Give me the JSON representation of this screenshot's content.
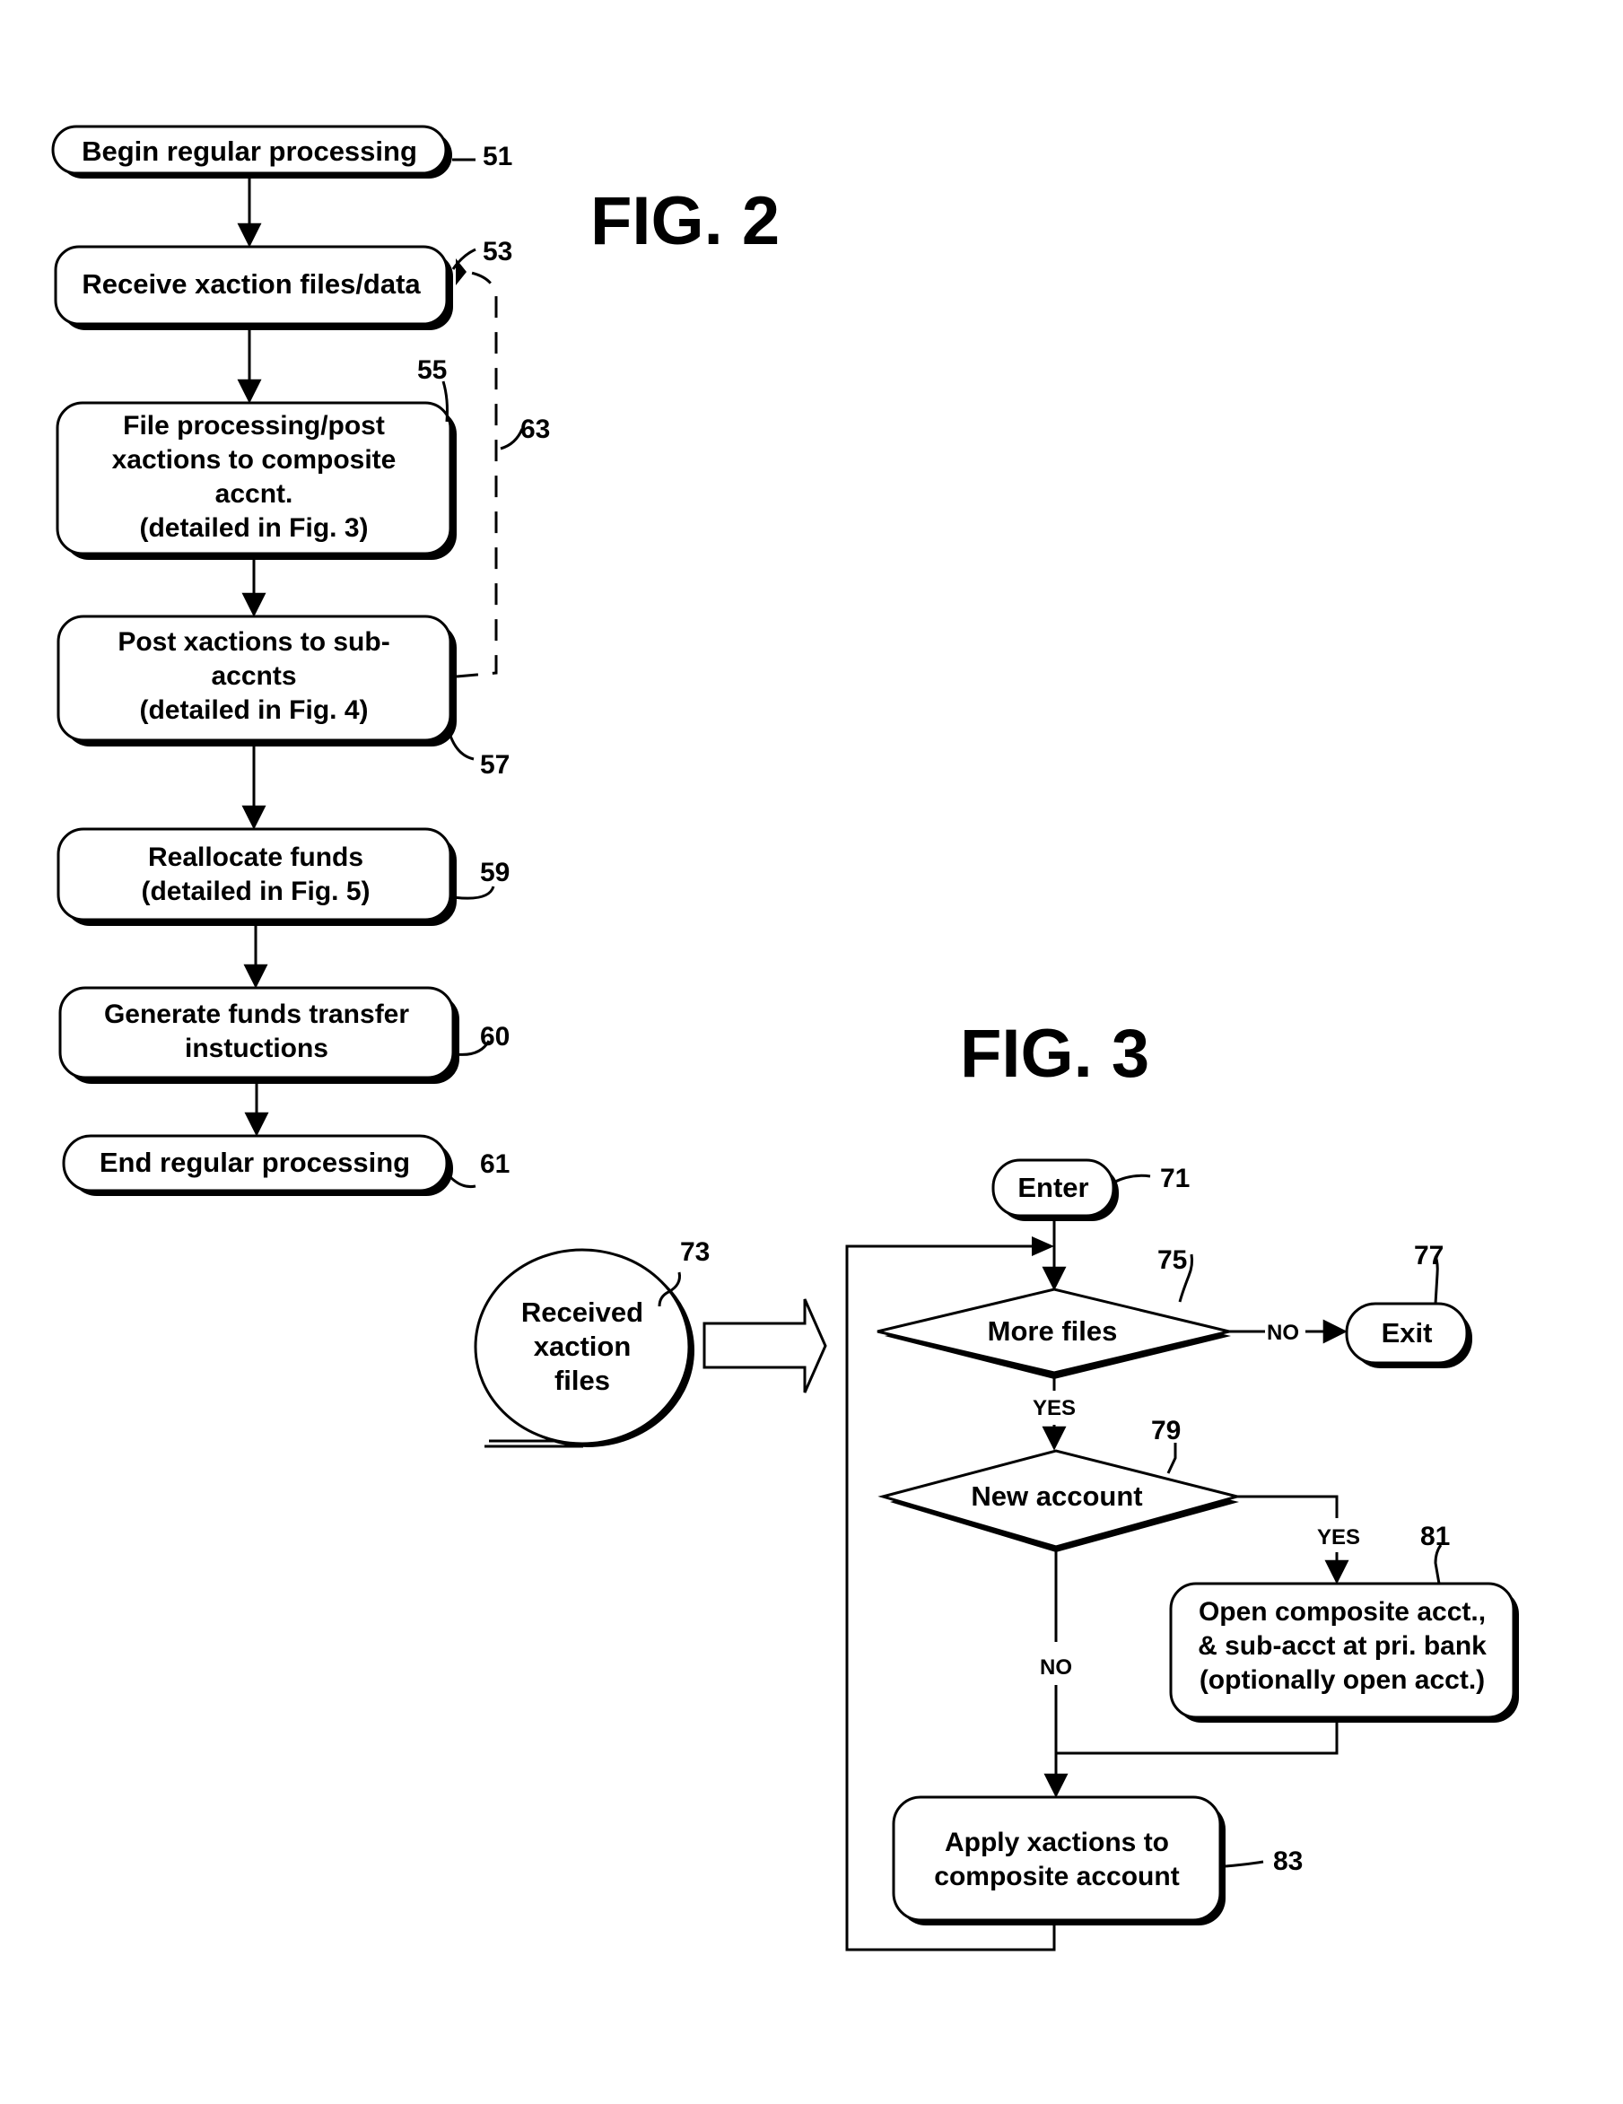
{
  "fig2": {
    "title": "FIG. 2",
    "nodes": [
      {
        "id": "51",
        "shape": "terminal",
        "lines": [
          "Begin regular processing"
        ]
      },
      {
        "id": "53",
        "shape": "process",
        "lines": [
          "Receive xaction files/data"
        ]
      },
      {
        "id": "55",
        "shape": "process",
        "lines": [
          "File processing/post",
          "xactions to composite",
          "accnt.",
          "(detailed in Fig. 3)"
        ]
      },
      {
        "id": "57",
        "shape": "process",
        "lines": [
          "Post xactions to sub-",
          "accnts",
          "(detailed in Fig. 4)"
        ]
      },
      {
        "id": "59",
        "shape": "process",
        "lines": [
          "Reallocate funds",
          "(detailed in Fig. 5)"
        ]
      },
      {
        "id": "60",
        "shape": "process",
        "lines": [
          "Generate funds transfer",
          "instuctions"
        ]
      },
      {
        "id": "61",
        "shape": "terminal",
        "lines": [
          "End regular processing"
        ]
      }
    ],
    "loop_ref": "63"
  },
  "fig3": {
    "title": "FIG. 3",
    "nodes": [
      {
        "id": "71",
        "shape": "terminal",
        "lines": [
          "Enter"
        ]
      },
      {
        "id": "73",
        "shape": "tape-reel",
        "lines": [
          "Received",
          "xaction",
          "files"
        ]
      },
      {
        "id": "75",
        "shape": "decision",
        "lines": [
          "More files"
        ]
      },
      {
        "id": "77",
        "shape": "terminal",
        "lines": [
          "Exit"
        ]
      },
      {
        "id": "79",
        "shape": "decision",
        "lines": [
          "New account"
        ]
      },
      {
        "id": "81",
        "shape": "process",
        "lines": [
          "Open composite acct.,",
          "& sub-acct at pri. bank",
          "(optionally open acct.)"
        ]
      },
      {
        "id": "83",
        "shape": "process",
        "lines": [
          "Apply xactions to",
          "composite account"
        ]
      }
    ],
    "edge_labels": {
      "more_files_no": "NO",
      "more_files_yes": "YES",
      "new_account_yes": "YES",
      "new_account_no": "NO"
    }
  }
}
